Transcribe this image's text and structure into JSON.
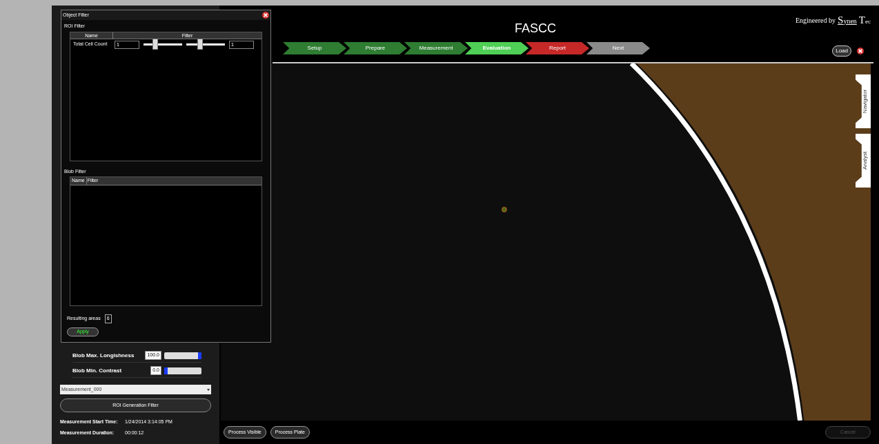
{
  "app_title": "FASCC",
  "steps": [
    {
      "label": "Setup",
      "color": "#2e7d32",
      "selected": false
    },
    {
      "label": "Prepare",
      "color": "#2e7d32",
      "selected": false
    },
    {
      "label": "Measurement",
      "color": "#2e7d32",
      "selected": false
    },
    {
      "label": "Evaluation",
      "color": "#4fcf55",
      "selected": true
    },
    {
      "label": "Report",
      "color": "#c62828",
      "selected": false
    },
    {
      "label": "Next",
      "color": "#8a8a8a",
      "selected": false
    }
  ],
  "logo": {
    "prefix": "Engineered by",
    "first": "S",
    "second": "ynen",
    "third": "T",
    "fourth": "ec"
  },
  "load_button": "Load",
  "side_tabs": [
    "Navigator",
    "Analyst"
  ],
  "bottom_buttons": [
    "Process Visible",
    "Process Plate"
  ],
  "cancel_button": {
    "label": "Cancel",
    "disabled": true
  },
  "left_panel": {
    "filters": [
      {
        "name": "Blob Max. Longishness",
        "value": "100.0",
        "level": 1
      },
      {
        "name": "Blob Min. Contrast",
        "value": "0.0",
        "level": 0
      }
    ],
    "dropdown": "Measurement_000",
    "roi_button": "ROI Generation Filter",
    "info": [
      {
        "label": "Measurement Start Time:",
        "value": "1/24/2014 3:14:05 PM"
      },
      {
        "label": "Measurement Duration:",
        "value": "00:00:12"
      }
    ]
  },
  "dialog": {
    "title": "Object Filter",
    "roi_label": "ROI Filter",
    "roi_columns": [
      "Name",
      "Filter"
    ],
    "roi_rows": [
      {
        "name": "Total Cell Count",
        "min": "1",
        "max": "1",
        "low": {
          "level": 0.3
        },
        "high": {
          "level": 0.35
        }
      }
    ],
    "blob_label": "Blob Filter",
    "blob_columns": [
      "Name",
      "Filter"
    ],
    "result_label": "Resulting areas",
    "result_value": "6",
    "apply": "Apply"
  }
}
